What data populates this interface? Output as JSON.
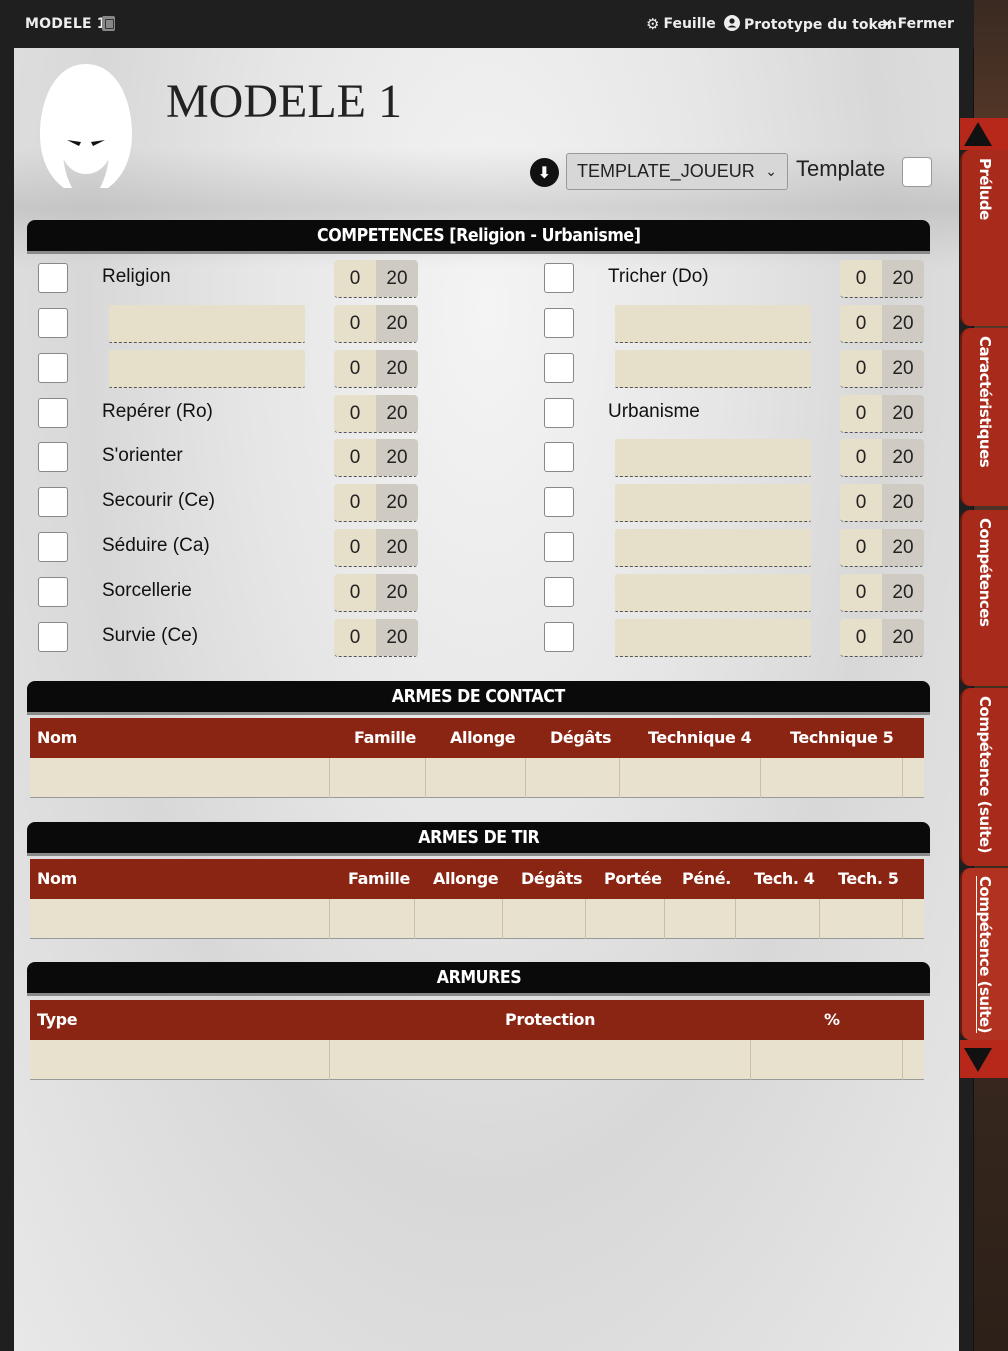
{
  "window": {
    "title": "MODELE 1",
    "actions": [
      {
        "label": "Feuille",
        "icon": "gear-icon"
      },
      {
        "label": "Prototype du token",
        "icon": "user-circle-icon"
      },
      {
        "label": "Fermer",
        "icon": "close-icon"
      }
    ]
  },
  "header": {
    "name": "MODELE 1",
    "template_select": "TEMPLATE_JOUEUR",
    "template_label": "Template"
  },
  "skills": {
    "title": "COMPETENCES [Religion - Urbanisme]",
    "left": [
      {
        "label": "Religion",
        "value": "0",
        "max": "20"
      },
      {
        "label": "",
        "value": "0",
        "max": "20"
      },
      {
        "label": "",
        "value": "0",
        "max": "20"
      },
      {
        "label": "Repérer (Ro)",
        "value": "0",
        "max": "20"
      },
      {
        "label": "S'orienter",
        "value": "0",
        "max": "20"
      },
      {
        "label": "Secourir (Ce)",
        "value": "0",
        "max": "20"
      },
      {
        "label": "Séduire (Ca)",
        "value": "0",
        "max": "20"
      },
      {
        "label": "Sorcellerie",
        "value": "0",
        "max": "20"
      },
      {
        "label": "Survie (Ce)",
        "value": "0",
        "max": "20"
      }
    ],
    "right": [
      {
        "label": "Tricher (Do)",
        "value": "0",
        "max": "20"
      },
      {
        "label": "",
        "value": "0",
        "max": "20"
      },
      {
        "label": "",
        "value": "0",
        "max": "20"
      },
      {
        "label": "Urbanisme",
        "value": "0",
        "max": "20"
      },
      {
        "label": "",
        "value": "0",
        "max": "20"
      },
      {
        "label": "",
        "value": "0",
        "max": "20"
      },
      {
        "label": "",
        "value": "0",
        "max": "20"
      },
      {
        "label": "",
        "value": "0",
        "max": "20"
      },
      {
        "label": "",
        "value": "0",
        "max": "20"
      }
    ]
  },
  "melee": {
    "title": "ARMES DE CONTACT",
    "columns": [
      "Nom",
      "Famille",
      "Allonge",
      "Dégâts",
      "Technique 4",
      "Technique 5"
    ]
  },
  "ranged": {
    "title": "ARMES DE TIR",
    "columns": [
      "Nom",
      "Famille",
      "Allonge",
      "Dégâts",
      "Portée",
      "Péné.",
      "Tech. 4",
      "Tech. 5"
    ]
  },
  "armor": {
    "title": "ARMURES",
    "columns": [
      "Type",
      "Protection",
      "%"
    ]
  },
  "side_tabs": [
    "Prélude",
    "Caractéristiques",
    "Compétences",
    "Compétence (suite)",
    "Compétence (suite)"
  ],
  "colors": {
    "accent": "#8b2513",
    "tab": "#a82a1b",
    "field": "#e6dfca"
  }
}
